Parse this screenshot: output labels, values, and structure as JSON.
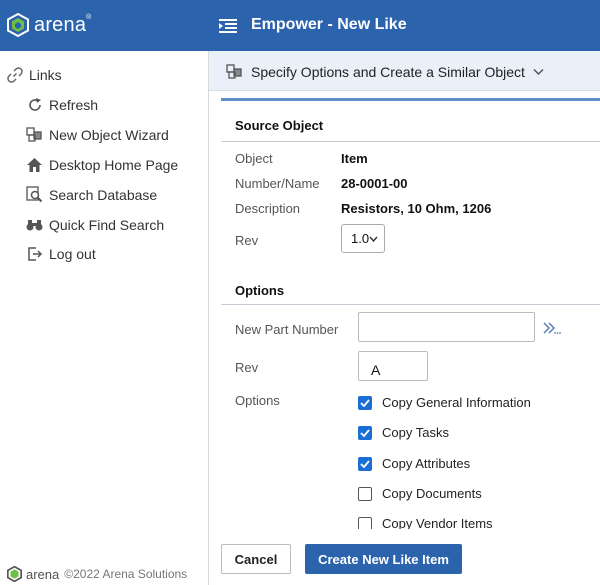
{
  "header": {
    "logo_text": "arena",
    "logo_mark": "®",
    "title": "Empower - New Like"
  },
  "sidebar": {
    "links_label": "Links",
    "items": [
      {
        "label": "Refresh",
        "icon": "refresh-icon"
      },
      {
        "label": "New Object Wizard",
        "icon": "cubes-icon"
      },
      {
        "label": "Desktop Home Page",
        "icon": "home-icon"
      },
      {
        "label": "Search Database",
        "icon": "search-database-icon"
      },
      {
        "label": "Quick Find Search",
        "icon": "binoculars-icon"
      },
      {
        "label": "Log out",
        "icon": "logout-icon"
      }
    ],
    "footer_brand": "arena",
    "footer_copyright": "©2022 Arena Solutions"
  },
  "subheader": {
    "title": "Specify Options and Create a Similar Object"
  },
  "source": {
    "section_title": "Source Object",
    "object_label": "Object",
    "object_value": "Item",
    "number_label": "Number/Name",
    "number_value": "28-0001-00",
    "description_label": "Description",
    "description_value": "Resistors, 10 Ohm, 1206",
    "rev_label": "Rev",
    "rev_value": "1.0"
  },
  "options": {
    "section_title": "Options",
    "new_part_label": "New Part Number",
    "new_part_value": "",
    "rev_label": "Rev",
    "rev_value": "A",
    "options_label": "Options",
    "checkboxes": [
      {
        "label": "Copy General Information",
        "checked": true
      },
      {
        "label": "Copy Tasks",
        "checked": true
      },
      {
        "label": "Copy Attributes",
        "checked": true
      },
      {
        "label": "Copy Documents",
        "checked": false
      },
      {
        "label": "Copy Vendor Items",
        "checked": false
      }
    ]
  },
  "buttons": {
    "cancel": "Cancel",
    "create": "Create New Like Item"
  },
  "colors": {
    "header_bg": "#2b63ad",
    "accent": "#1a6fd6",
    "subbar_bg": "#e9f0f8"
  }
}
